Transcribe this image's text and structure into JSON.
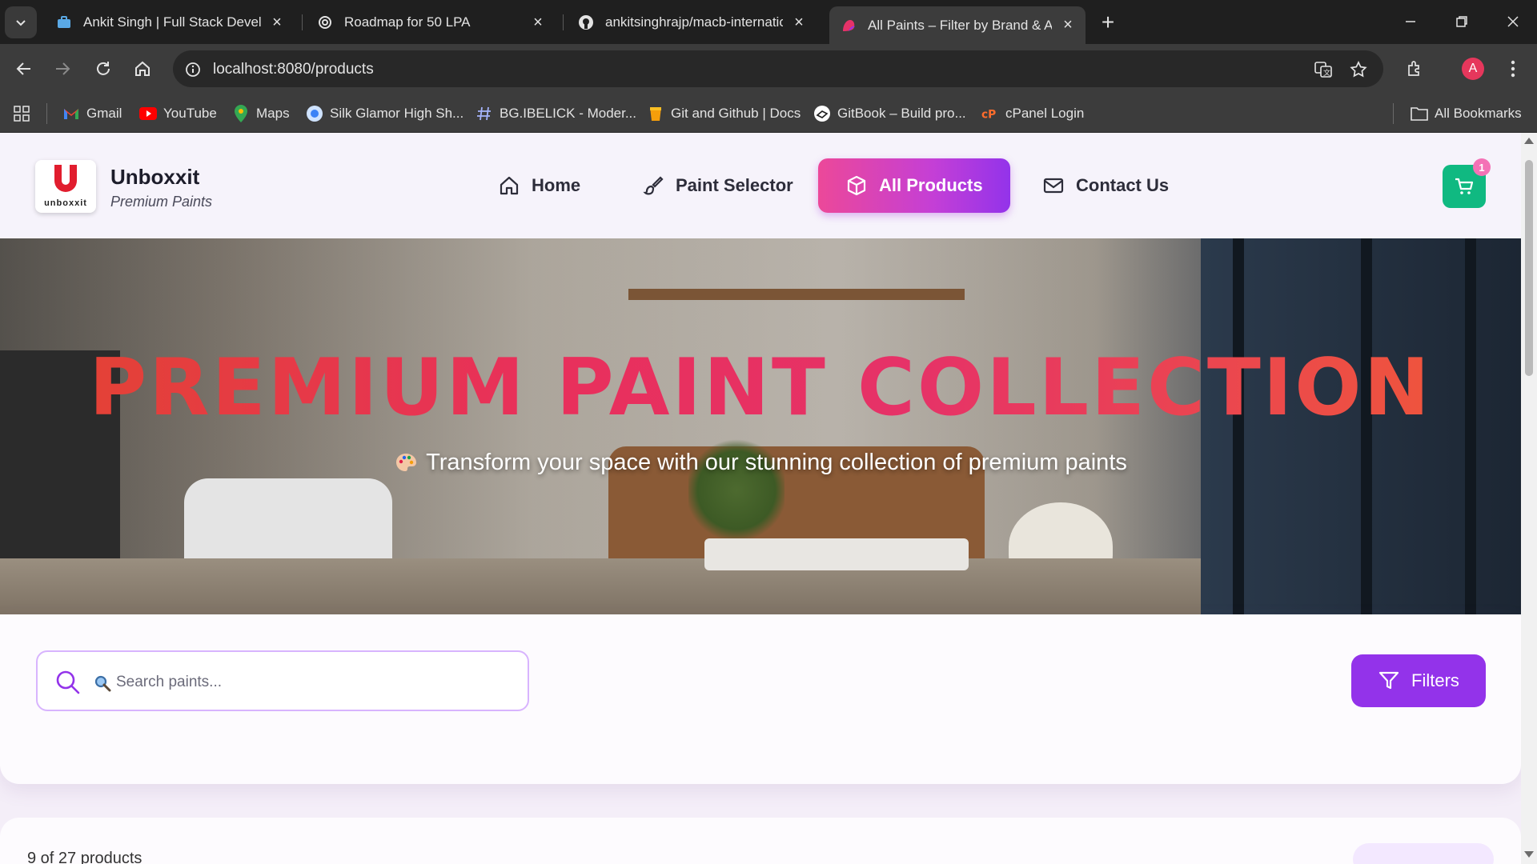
{
  "browser": {
    "tabs": [
      {
        "title": "Ankit Singh | Full Stack Develop",
        "icon": "briefcase-icon",
        "active": false
      },
      {
        "title": "Roadmap for 50 LPA",
        "icon": "openai-icon",
        "active": false
      },
      {
        "title": "ankitsinghrajp/macb-internatio",
        "icon": "github-icon",
        "active": false
      },
      {
        "title": "All Paints – Filter by Brand & Ap",
        "icon": "paint-icon",
        "active": true
      }
    ],
    "url": "localhost:8080/products",
    "profile_initial": "A",
    "bookmarks": [
      {
        "label": "Gmail",
        "icon": "gmail-icon"
      },
      {
        "label": "YouTube",
        "icon": "youtube-icon"
      },
      {
        "label": "Maps",
        "icon": "maps-icon"
      },
      {
        "label": "Silk Glamor High Sh...",
        "icon": "globe-icon"
      },
      {
        "label": "BG.IBELICK - Moder...",
        "icon": "hash-icon"
      },
      {
        "label": "Git and Github | Docs",
        "icon": "cup-icon"
      },
      {
        "label": "GitBook – Build pro...",
        "icon": "gitbook-icon"
      },
      {
        "label": "cPanel Login",
        "icon": "cpanel-icon"
      }
    ],
    "all_bookmarks": "All Bookmarks"
  },
  "site": {
    "logo_word": "unboxxit",
    "brand_name": "Unboxxit",
    "brand_tagline": "Premium Paints",
    "nav": [
      {
        "label": "Home",
        "icon": "home-icon",
        "active": false
      },
      {
        "label": "Paint Selector",
        "icon": "brush-icon",
        "active": false
      },
      {
        "label": "All Products",
        "icon": "box-icon",
        "active": true
      },
      {
        "label": "Contact Us",
        "icon": "mail-icon",
        "active": false
      }
    ],
    "cart_count": "1"
  },
  "hero": {
    "title": "PREMIUM PAINT COLLECTION",
    "subtitle": "Transform your space with our stunning collection of premium paints"
  },
  "filters": {
    "search_placeholder": "Search paints...",
    "filters_label": "Filters"
  },
  "results": {
    "count_text": "9 of 27 products"
  },
  "colors": {
    "accent_purple": "#9333ea",
    "accent_pink": "#ec4899",
    "cart_green": "#10b981",
    "hero_title_red": "#e8305b"
  }
}
